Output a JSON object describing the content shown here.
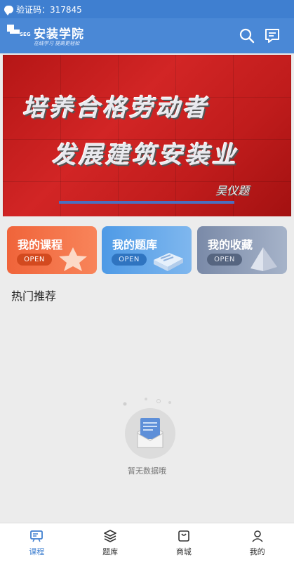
{
  "status": {
    "message": "验证码：317845"
  },
  "header": {
    "brand": "安装学院",
    "slogan": "在线学习  提高更轻松",
    "logo_text": "SEG"
  },
  "banner": {
    "line1": "培养合格劳动者",
    "line2": "发展建筑安装业",
    "signature": "吴仪题"
  },
  "cards": [
    {
      "title": "我的课程",
      "open": "OPEN"
    },
    {
      "title": "我的题库",
      "open": "OPEN"
    },
    {
      "title": "我的收藏",
      "open": "OPEN"
    }
  ],
  "section": {
    "title": "热门推荐"
  },
  "empty": {
    "text": "暂无数据哦"
  },
  "tabs": [
    {
      "label": "课程",
      "icon": "course-icon"
    },
    {
      "label": "题库",
      "icon": "layers-icon"
    },
    {
      "label": "商城",
      "icon": "shop-icon"
    },
    {
      "label": "我的",
      "icon": "user-icon"
    }
  ],
  "colors": {
    "primary": "#4a88d6",
    "active_tab": "#3f7fd0"
  }
}
